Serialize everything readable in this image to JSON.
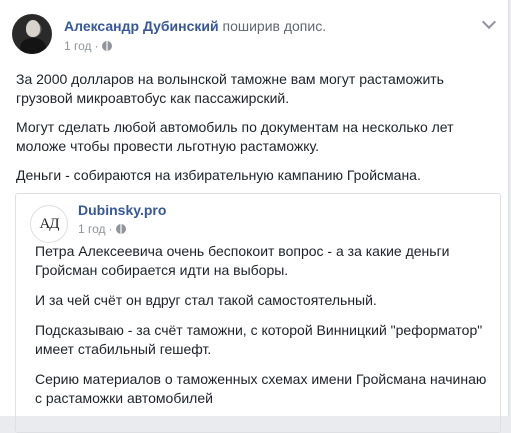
{
  "post": {
    "author": "Александр Дубинский",
    "action": " поширив допис.",
    "time": "1 год",
    "dot": "·",
    "privacy_icon": "globe-icon",
    "menu_icon": "chevron-down-icon",
    "paragraphs": [
      "За 2000 долларов на волынской таможне вам могут растаможить грузовой микроавтобус как пассажирский.",
      "Могут сделать любой автомобиль по документам на несколько лет моложе чтобы провести льготную растаможку.",
      "Деньги - собираются на избирательную кампанию Гройсмана."
    ]
  },
  "shared": {
    "page_avatar_text": "АД",
    "page_name": "Dubinsky.pro",
    "time": "1 год",
    "dot": "·",
    "privacy_icon": "globe-icon",
    "paragraphs": [
      "Петра Алексеевича очень беспокоит вопрос - а за какие деньги Гройсман собирается идти на выборы.",
      "И за чей счёт он вдруг стал такой самостоятельный.",
      "Подсказываю - за счёт таможни, с которой Винницкий \"реформатор\" имеет стабильный гешефт.",
      "Серию материалов о таможенных схемах имени Гройсмана начинаю с растаможки автомобилей"
    ]
  }
}
